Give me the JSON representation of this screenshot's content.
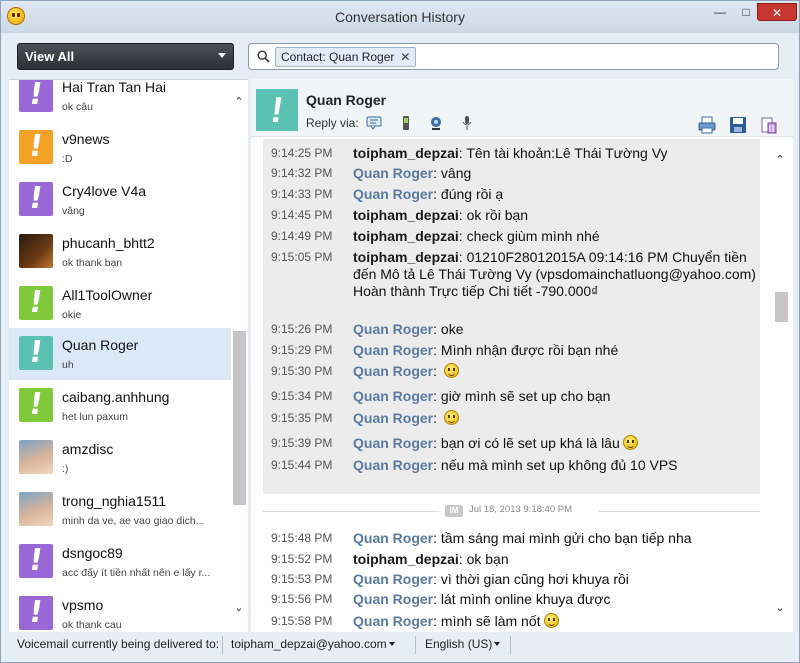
{
  "window": {
    "title": "Conversation History"
  },
  "filter": {
    "selected": "View All"
  },
  "search": {
    "tag": "Contact: Quan Roger"
  },
  "contacts": [
    {
      "name": "Hai Tran Tan Hai",
      "status": "ok cậu",
      "avatar": "purple"
    },
    {
      "name": "v9news",
      "status": ":D",
      "avatar": "orange"
    },
    {
      "name": "Cry4love V4a",
      "status": "vâng",
      "avatar": "purple"
    },
    {
      "name": "phucanh_bhtt2",
      "status": "ok thank bạn",
      "avatar": "guitar"
    },
    {
      "name": "All1ToolOwner",
      "status": "okie",
      "avatar": "green"
    },
    {
      "name": "Quan Roger",
      "status": "uh",
      "avatar": "teal"
    },
    {
      "name": "caibang.anhhung",
      "status": "het lun paxum",
      "avatar": "green"
    },
    {
      "name": "amzdisc",
      "status": ":)",
      "avatar": "baby"
    },
    {
      "name": "trong_nghia1511",
      "status": "minh da ve, ae vao giao dich...",
      "avatar": "baby"
    },
    {
      "name": "dsngoc89",
      "status": "acc đấy ít tiền nhất nên e lấy r...",
      "avatar": "purple"
    },
    {
      "name": "vpsmo",
      "status": "ok thank cau",
      "avatar": "purple"
    }
  ],
  "conversation": {
    "contact_name": "Quan Roger",
    "reply_via_label": "Reply via:",
    "messages": [
      {
        "time": "9:14:25 PM",
        "sender": "toipham_depzai",
        "me": true,
        "text": "Tên tài khoản:Lê Thái Tường Vy"
      },
      {
        "time": "9:14:32 PM",
        "sender": "Quan Roger",
        "me": false,
        "text": "vâng"
      },
      {
        "time": "9:14:33 PM",
        "sender": "Quan Roger",
        "me": false,
        "text": "đúng rồi ạ"
      },
      {
        "time": "9:14:45 PM",
        "sender": "toipham_depzai",
        "me": true,
        "text": "ok rồi bạn"
      },
      {
        "time": "9:14:49 PM",
        "sender": "toipham_depzai",
        "me": true,
        "text": "check giùm mình nhé"
      },
      {
        "time": "9:15:05 PM",
        "sender": "toipham_depzai",
        "me": true,
        "text": "01210F28012015A 09:14:16 PM Chuyển tiền đến Mô tả Lê Thái Tường Vy (vpsdomainchatluong@yahoo.com) Hoàn thành Trực tiếp Chi tiết -790.000₫"
      },
      {
        "time": "9:15:26 PM",
        "sender": "Quan Roger",
        "me": false,
        "text": "oke"
      },
      {
        "time": "9:15:29 PM",
        "sender": "Quan Roger",
        "me": false,
        "text": "Mình nhận được rồi bạn nhé"
      },
      {
        "time": "9:15:30 PM",
        "sender": "Quan Roger",
        "me": false,
        "text": "",
        "emoticon": "smile"
      },
      {
        "time": "9:15:34 PM",
        "sender": "Quan Roger",
        "me": false,
        "text": "giờ mình sẽ set up cho bạn"
      },
      {
        "time": "9:15:35 PM",
        "sender": "Quan Roger",
        "me": false,
        "text": "",
        "emoticon": "smile"
      },
      {
        "time": "9:15:39 PM",
        "sender": "Quan Roger",
        "me": false,
        "text": "bạn ơi có lẽ set up khá là lâu",
        "emoticon": "grin"
      },
      {
        "time": "9:15:44 PM",
        "sender": "Quan Roger",
        "me": false,
        "text": "nếu mà mình set up không đủ 10 VPS"
      }
    ],
    "session_badge": "IM",
    "session_label": "Jul 18, 2013 9:18:40 PM",
    "messages2": [
      {
        "time": "9:15:48 PM",
        "sender": "Quan Roger",
        "me": false,
        "text": "tầm sáng mai mình gửi cho bạn tiếp nha"
      },
      {
        "time": "9:15:52 PM",
        "sender": "toipham_depzai",
        "me": true,
        "text": "ok bạn"
      },
      {
        "time": "9:15:53 PM",
        "sender": "Quan Roger",
        "me": false,
        "text": "vì thời gian cũng hơi khuya rồi"
      },
      {
        "time": "9:15:56 PM",
        "sender": "Quan Roger",
        "me": false,
        "text": "lát mình online khuya được"
      },
      {
        "time": "9:15:58 PM",
        "sender": "Quan Roger",
        "me": false,
        "text": "mình sẽ làm nốt",
        "emoticon": "grin"
      }
    ]
  },
  "statusbar": {
    "voicemail_label": "Voicemail currently being delivered to:",
    "voicemail_target": "toipham_depzai@yahoo.com",
    "language": "English (US)"
  }
}
